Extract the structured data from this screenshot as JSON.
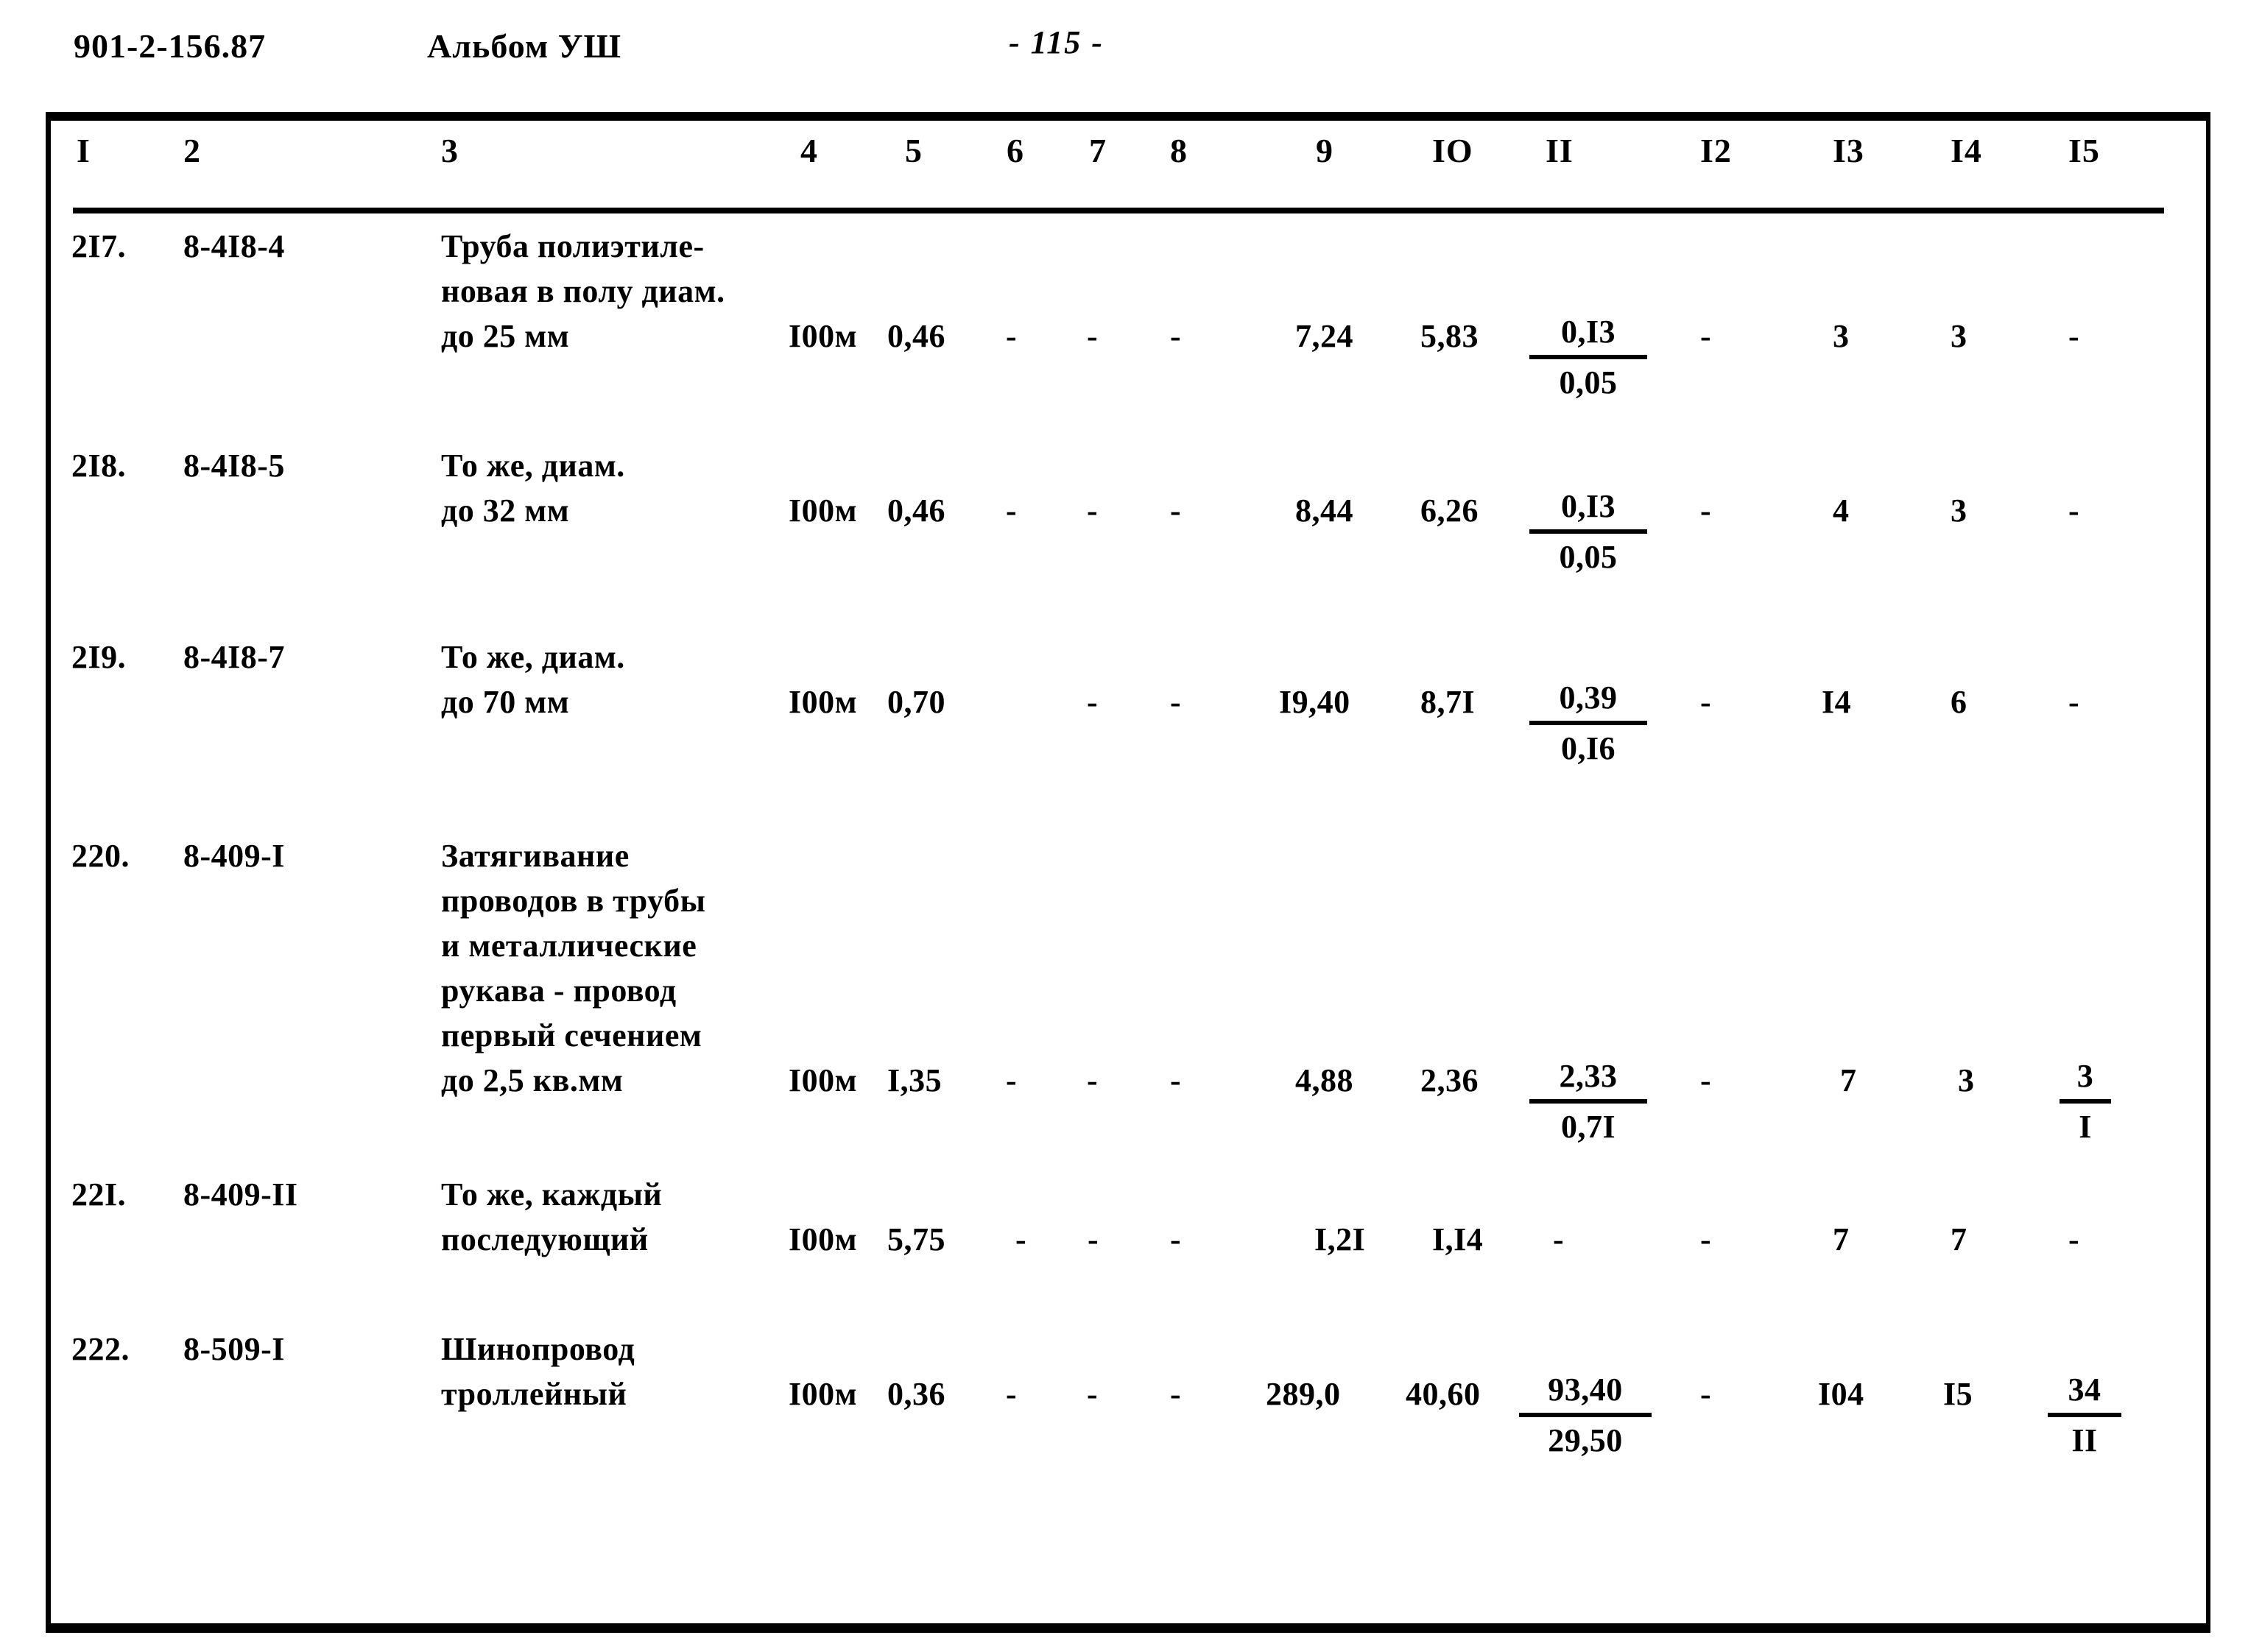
{
  "header": {
    "doc_code": "901-2-156.87",
    "album": "Альбом УШ",
    "page_number": "- 115 -"
  },
  "table": {
    "column_headers": [
      "I",
      "2",
      "3",
      "4",
      "5",
      "6",
      "7",
      "8",
      "9",
      "IO",
      "II",
      "I2",
      "I3",
      "I4",
      "I5"
    ],
    "rows": [
      {
        "no": "2I7.",
        "code": "8-4I8-4",
        "desc": [
          "Труба полиэтиле-",
          "новая в полу диам.",
          "до 25 мм"
        ],
        "unit": "I00м",
        "c5": "0,46",
        "c6": "-",
        "c7": "-",
        "c8": "-",
        "c9": "7,24",
        "c10": "5,83",
        "c11_num": "0,I3",
        "c11_den": "0,05",
        "c12": "-",
        "c13": "3",
        "c14": "3",
        "c15": "-"
      },
      {
        "no": "2I8.",
        "code": "8-4I8-5",
        "desc": [
          "То же, диам.",
          "до 32 мм"
        ],
        "unit": "I00м",
        "c5": "0,46",
        "c6": "-",
        "c7": "-",
        "c8": "-",
        "c9": "8,44",
        "c10": "6,26",
        "c11_num": "0,I3",
        "c11_den": "0,05",
        "c12": "-",
        "c13": "4",
        "c14": "3",
        "c15": "-"
      },
      {
        "no": "2I9.",
        "code": "8-4I8-7",
        "desc": [
          "То же, диам.",
          "до 70 мм"
        ],
        "unit": "I00м",
        "c5": "0,70",
        "c6": "",
        "c7": "-",
        "c8": "-",
        "c9": "I9,40",
        "c10": "8,7I",
        "c11_num": "0,39",
        "c11_den": "0,I6",
        "c12": "-",
        "c13": "I4",
        "c14": "6",
        "c15": "-"
      },
      {
        "no": "220.",
        "code": "8-409-I",
        "desc": [
          "Затягивание",
          "проводов в трубы",
          "и металлические",
          "рукава - провод",
          "первый сечением",
          "до 2,5 кв.мм"
        ],
        "unit": "I00м",
        "c5": "I,35",
        "c6": "-",
        "c7": "-",
        "c8": "-",
        "c9": "4,88",
        "c10": "2,36",
        "c11_num": "2,33",
        "c11_den": "0,7I",
        "c12": "-",
        "c13": "7",
        "c14": "3",
        "c15_num": "3",
        "c15_den": "I"
      },
      {
        "no": "22I.",
        "code": "8-409-II",
        "desc": [
          "То же, каждый",
          "последующий"
        ],
        "unit": "I00м",
        "c5": "5,75",
        "c6": "-",
        "c7": "-",
        "c8": "-",
        "c9": "I,2I",
        "c10": "I,I4",
        "c11": "-",
        "c12": "-",
        "c13": "7",
        "c14": "7",
        "c15": "-"
      },
      {
        "no": "222.",
        "code": "8-509-I",
        "desc": [
          "Шинопровод",
          "троллейный"
        ],
        "unit": "I00м",
        "c5": "0,36",
        "c6": "-",
        "c7": "-",
        "c8": "-",
        "c9": "289,0",
        "c10": "40,60",
        "c11_num": "93,40",
        "c11_den": "29,50",
        "c12": "-",
        "c13": "I04",
        "c14": "I5",
        "c15_num": "34",
        "c15_den": "II"
      }
    ]
  }
}
